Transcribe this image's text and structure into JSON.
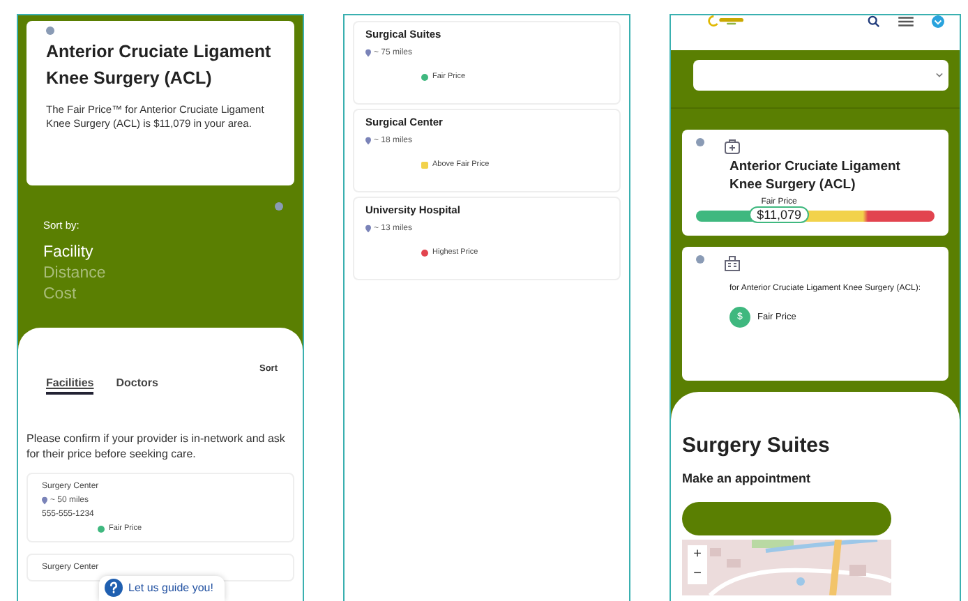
{
  "left_screen": {
    "procedure_card": {
      "title": "Anterior Cruciate Ligament Knee Surgery (ACL)",
      "description": "The Fair Price™ for Anterior Cruciate Ligament Knee Surgery (ACL) is $11,079 in your area."
    },
    "sort_by": {
      "label": "Sort by:",
      "options": [
        {
          "label": "Facility",
          "selected": true
        },
        {
          "label": "Distance",
          "selected": false
        },
        {
          "label": "Cost",
          "selected": false
        }
      ]
    },
    "sort_button": "Sort",
    "tabs": [
      {
        "label": "Facilities",
        "selected": true
      },
      {
        "label": "Doctors",
        "selected": false
      }
    ],
    "notice": "Please confirm if your provider is in-network and ask for their price before seeking care.",
    "facilities": [
      {
        "name": "Surgery Center",
        "distance": "~ 50 miles",
        "phone": "555-555-1234",
        "price_label": "Fair Price",
        "color": "#3fb87f"
      },
      {
        "name": "Surgery Center"
      }
    ],
    "help_button": "Let us guide you!"
  },
  "middle_screen": {
    "facilities": [
      {
        "name": "Surgical Suites",
        "distance": "~ 75 miles",
        "price_label": "Fair Price",
        "color": "#3fb87f"
      },
      {
        "name": "Surgical Center",
        "distance": "~ 18 miles",
        "price_label": "Above Fair Price",
        "color": "#f2d24b"
      },
      {
        "name": "University Hospital",
        "distance": "~ 13 miles",
        "price_label": "Highest Price",
        "color": "#e2444f"
      }
    ]
  },
  "right_screen": {
    "procedure_card": {
      "title": "Anterior Cruciate Ligament Knee Surgery (ACL)",
      "price_label": "Fair Price",
      "price": "$11,079"
    },
    "facility_card": {
      "description": "for Anterior Cruciate Ligament Knee Surgery (ACL):",
      "badge": "$",
      "rating": "Fair Price"
    },
    "heading": "Surgery Suites",
    "subheading": "Make an appointment",
    "map": {
      "zoom_in": "+",
      "zoom_out": "−"
    }
  }
}
